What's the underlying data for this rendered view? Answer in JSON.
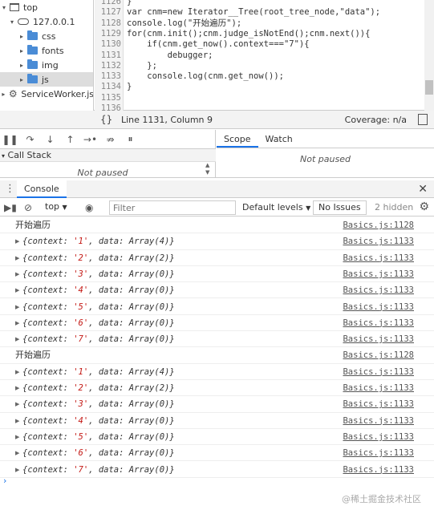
{
  "file_tree": {
    "items": [
      {
        "label": "top",
        "arrow": "▾",
        "icon": "window-icon"
      },
      {
        "label": "127.0.0.1",
        "arrow": "▾",
        "icon": "cloud-icon"
      },
      {
        "label": "css",
        "arrow": "▸",
        "icon": "folder-icon"
      },
      {
        "label": "fonts",
        "arrow": "▸",
        "icon": "folder-icon"
      },
      {
        "label": "img",
        "arrow": "▸",
        "icon": "folder-icon"
      },
      {
        "label": "js",
        "arrow": "▸",
        "icon": "folder-icon",
        "selected": true
      },
      {
        "label": "ServiceWorker.js",
        "arrow": "▸",
        "icon": "gear-icon"
      }
    ]
  },
  "editor": {
    "lines": [
      {
        "n": "1126",
        "code": "}"
      },
      {
        "n": "1127",
        "code": "var cnm=new Iterator__Tree(root_tree_node,\"data\");"
      },
      {
        "n": "1128",
        "code": "console.log(\"开始遍历\");"
      },
      {
        "n": "1129",
        "code": "for(cnm.init();cnm.judge_isNotEnd();cnm.next()){"
      },
      {
        "n": "1130",
        "code": "    if(cnm.get_now().context===\"7\"){"
      },
      {
        "n": "1131",
        "code": "        debugger;"
      },
      {
        "n": "1132",
        "code": "    };"
      },
      {
        "n": "1133",
        "code": "    console.log(cnm.get_now());"
      },
      {
        "n": "1134",
        "code": "}"
      },
      {
        "n": "1135",
        "code": ""
      },
      {
        "n": "1136",
        "code": ""
      }
    ]
  },
  "status_bar": {
    "braces": "{}",
    "cursor": "Line 1131, Column 9",
    "coverage": "Coverage: n/a"
  },
  "debugger": {
    "call_stack_label": "Call Stack",
    "call_stack_status": "Not paused",
    "tabs": [
      "Scope",
      "Watch"
    ],
    "scope_status": "Not paused"
  },
  "drawer": {
    "tab": "Console"
  },
  "console_toolbar": {
    "context": "top",
    "filter_placeholder": "Filter",
    "levels": "Default levels",
    "issues": "No Issues",
    "hidden": "2 hidden"
  },
  "console": {
    "messages": [
      {
        "type": "text",
        "text": "开始遍历",
        "src": "Basics.js:1128"
      },
      {
        "type": "obj",
        "ctx": "'1'",
        "data": "Array(4)",
        "src": "Basics.js:1133"
      },
      {
        "type": "obj",
        "ctx": "'2'",
        "data": "Array(2)",
        "src": "Basics.js:1133"
      },
      {
        "type": "obj",
        "ctx": "'3'",
        "data": "Array(0)",
        "src": "Basics.js:1133"
      },
      {
        "type": "obj",
        "ctx": "'4'",
        "data": "Array(0)",
        "src": "Basics.js:1133"
      },
      {
        "type": "obj",
        "ctx": "'5'",
        "data": "Array(0)",
        "src": "Basics.js:1133"
      },
      {
        "type": "obj",
        "ctx": "'6'",
        "data": "Array(0)",
        "src": "Basics.js:1133"
      },
      {
        "type": "obj",
        "ctx": "'7'",
        "data": "Array(0)",
        "src": "Basics.js:1133"
      },
      {
        "type": "text",
        "text": "开始遍历",
        "src": "Basics.js:1128"
      },
      {
        "type": "obj",
        "ctx": "'1'",
        "data": "Array(4)",
        "src": "Basics.js:1133"
      },
      {
        "type": "obj",
        "ctx": "'2'",
        "data": "Array(2)",
        "src": "Basics.js:1133"
      },
      {
        "type": "obj",
        "ctx": "'3'",
        "data": "Array(0)",
        "src": "Basics.js:1133"
      },
      {
        "type": "obj",
        "ctx": "'4'",
        "data": "Array(0)",
        "src": "Basics.js:1133"
      },
      {
        "type": "obj",
        "ctx": "'5'",
        "data": "Array(0)",
        "src": "Basics.js:1133"
      },
      {
        "type": "obj",
        "ctx": "'6'",
        "data": "Array(0)",
        "src": "Basics.js:1133"
      },
      {
        "type": "obj",
        "ctx": "'7'",
        "data": "Array(0)",
        "src": "Basics.js:1133"
      }
    ],
    "prompt": "›"
  },
  "watermark": "@稀土掘金技术社区"
}
